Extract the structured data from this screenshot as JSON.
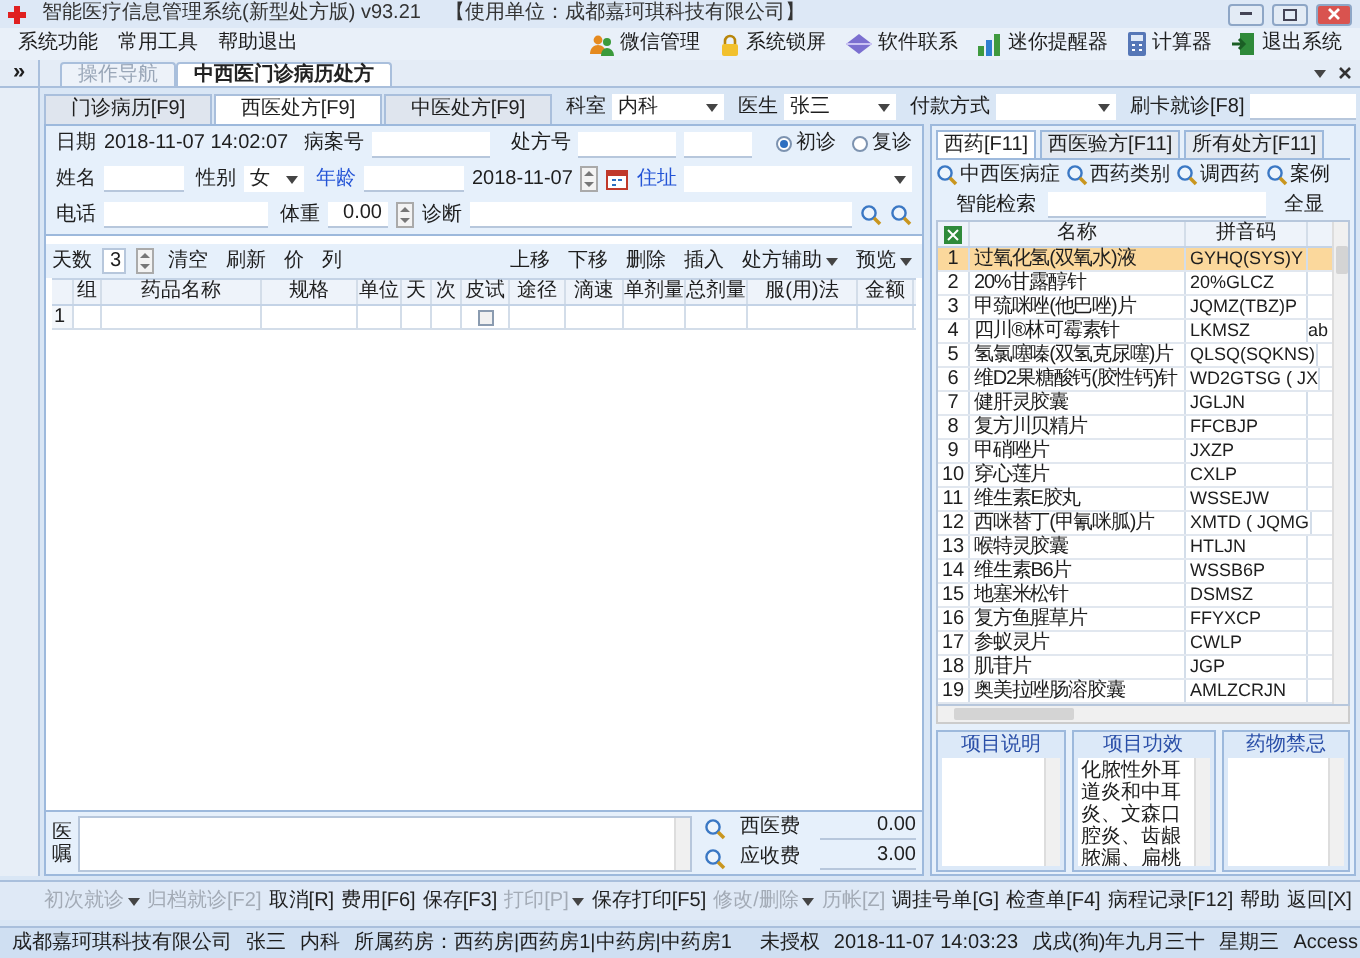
{
  "window": {
    "title": "智能医疗信息管理系统(新型处方版) v93.21",
    "org": "【使用单位：成都嘉珂琪科技有限公司】"
  },
  "menu": [
    "系统功能",
    "常用工具",
    "帮助退出"
  ],
  "toolbar": [
    "微信管理",
    "系统锁屏",
    "软件联系",
    "迷你提醒器",
    "计算器",
    "退出系统"
  ],
  "sidebar_toggle": "»",
  "doc_tabs": [
    {
      "label": "操作导航",
      "selected": false
    },
    {
      "label": "中西医门诊病历处方",
      "selected": true
    }
  ],
  "form_tabs": [
    {
      "label": "门诊病历[F9]",
      "selected": false
    },
    {
      "label": "西医处方[F9]",
      "selected": true
    },
    {
      "label": "中医处方[F9]",
      "selected": false
    }
  ],
  "department": {
    "label": "科室",
    "value": "内科"
  },
  "doctor": {
    "label": "医生",
    "value": "张三"
  },
  "payment": {
    "label": "付款方式"
  },
  "card": {
    "label": "刷卡就诊[F8]"
  },
  "record": {
    "date_label": "日期",
    "date": "2018-11-07 14:02:07",
    "case_label": "病案号",
    "rx_label": "处方号",
    "visit": [
      {
        "label": "初诊",
        "selected": true
      },
      {
        "label": "复诊",
        "selected": false
      }
    ],
    "name_label": "姓名",
    "sex_label": "性别",
    "sex": "女",
    "age_label": "年龄",
    "birth": "2018-11-07",
    "address_label": "住址",
    "phone_label": "电话",
    "weight_label": "体重",
    "weight": "0.00",
    "diagnosis_label": "诊断"
  },
  "rx_toolbar": {
    "days_label": "天数",
    "days": "3",
    "left": [
      "清空",
      "刷新",
      "价",
      "列"
    ],
    "right": [
      {
        "label": "上移",
        "dropdown": false
      },
      {
        "label": "下移",
        "dropdown": false
      },
      {
        "label": "删除",
        "dropdown": false
      },
      {
        "label": "插入",
        "dropdown": false
      },
      {
        "label": "处方辅助",
        "dropdown": true
      },
      {
        "label": "预览",
        "dropdown": true
      }
    ]
  },
  "rx_table": {
    "columns": [
      "组",
      "药品名称",
      "规格",
      "单位",
      "天",
      "次",
      "皮试",
      "途径",
      "滴速",
      "单剂量",
      "总剂量",
      "服(用)法",
      "金额"
    ],
    "rows": [
      {
        "number": "1",
        "skin_test": false
      }
    ]
  },
  "advice_label": "医嘱",
  "fees": [
    {
      "label": "西医费",
      "value": "0.00"
    },
    {
      "label": "应收费",
      "value": "3.00"
    }
  ],
  "drug_tabs": [
    {
      "label": "西药[F11]",
      "selected": true
    },
    {
      "label": "西医验方[F11]",
      "selected": false
    },
    {
      "label": "所有处方[F11]",
      "selected": false
    }
  ],
  "drug_filters": [
    "中西医病症",
    "西药类别",
    "调西药",
    "案例"
  ],
  "smart_search": {
    "label": "智能检索",
    "button": "全显"
  },
  "drug_table": {
    "columns": [
      "名称",
      "拼音码"
    ],
    "rows": [
      {
        "number": "1",
        "name": "过氧化氢(双氧水)液",
        "pinyin": "GYHQ(SYS)Y",
        "selected": true
      },
      {
        "number": "2",
        "name": "20%甘露醇针",
        "pinyin": "20%GLCZ",
        "selected": false
      },
      {
        "number": "3",
        "name": "甲巯咪唑(他巴唑)片",
        "pinyin": "JQMZ(TBZ)P",
        "selected": false
      },
      {
        "number": "4",
        "name": "四川®林可霉素针",
        "pinyin": "LKMSZ",
        "column_4": "ab",
        "selected": false
      },
      {
        "number": "5",
        "name": "氢氯噻嗪(双氢克尿噻)片",
        "pinyin": "QLSQ(SQKNS)",
        "selected": false
      },
      {
        "number": "6",
        "name": "维D2果糖酸钙(胶性钙)针",
        "pinyin": "WD2GTSG ( JX",
        "selected": false
      },
      {
        "number": "7",
        "name": "健肝灵胶囊",
        "pinyin": "JGLJN",
        "selected": false
      },
      {
        "number": "8",
        "name": "复方川贝精片",
        "pinyin": "FFCBJP",
        "selected": false
      },
      {
        "number": "9",
        "name": "甲硝唑片",
        "pinyin": "JXZP",
        "selected": false
      },
      {
        "number": "10",
        "name": "穿心莲片",
        "pinyin": "CXLP",
        "selected": false
      },
      {
        "number": "11",
        "name": "维生素E胶丸",
        "pinyin": "WSSEJW",
        "selected": false
      },
      {
        "number": "12",
        "name": "西咪替丁(甲氰咪胍)片",
        "pinyin": "XMTD ( JQMG",
        "selected": false
      },
      {
        "number": "13",
        "name": "喉特灵胶囊",
        "pinyin": "HTLJN",
        "selected": false
      },
      {
        "number": "14",
        "name": "维生素B6片",
        "pinyin": "WSSB6P",
        "selected": false
      },
      {
        "number": "15",
        "name": "地塞米松针",
        "pinyin": "DSMSZ",
        "selected": false
      },
      {
        "number": "16",
        "name": "复方鱼腥草片",
        "pinyin": "FFYXCP",
        "selected": false
      },
      {
        "number": "17",
        "name": "参蚁灵片",
        "pinyin": "CWLP",
        "selected": false
      },
      {
        "number": "18",
        "name": "肌苷片",
        "pinyin": "JGP",
        "selected": false
      },
      {
        "number": "19",
        "name": "奥美拉唑肠溶胶囊",
        "pinyin": "AMLZCRJN",
        "selected": false
      }
    ]
  },
  "info_boxes": [
    {
      "title": "项目说明"
    },
    {
      "title": "项目功效",
      "text": "化脓性外耳道炎和中耳炎、文森口腔炎、齿龈脓漏、扁桃"
    },
    {
      "title": "药物禁忌"
    }
  ],
  "actions": [
    {
      "label": "初次就诊",
      "disabled": true,
      "dropdown": true
    },
    {
      "label": "归档就诊[F2]",
      "disabled": true,
      "dropdown": false
    },
    {
      "label": "取消[R]",
      "disabled": false,
      "dropdown": false
    },
    {
      "label": "费用[F6]",
      "disabled": false,
      "dropdown": false
    },
    {
      "label": "保存[F3]",
      "disabled": false,
      "dropdown": false
    },
    {
      "label": "打印[P]",
      "disabled": true,
      "dropdown": true
    },
    {
      "label": "保存打印[F5]",
      "disabled": false,
      "dropdown": false
    },
    {
      "label": "修改/删除",
      "disabled": true,
      "dropdown": true
    },
    {
      "label": "历帐[Z]",
      "disabled": true,
      "dropdown": false
    },
    {
      "label": "调挂号单[G]",
      "disabled": false,
      "dropdown": false
    },
    {
      "label": "检查单[F4]",
      "disabled": false,
      "dropdown": false
    },
    {
      "label": "病程记录[F12]",
      "disabled": false,
      "dropdown": false
    },
    {
      "label": "帮助",
      "disabled": false,
      "dropdown": false
    },
    {
      "label": "返回[X]",
      "disabled": false,
      "dropdown": false
    }
  ],
  "status_bar": {
    "left": [
      "成都嘉珂琪科技有限公司",
      "张三",
      "内科",
      "所属药房：西药房|西药房1|中药房|中药房1"
    ],
    "right": [
      "未授权",
      "2018-11-07 14:03:23",
      "戊戌(狗)年九月三十",
      "星期三",
      "Access"
    ]
  }
}
